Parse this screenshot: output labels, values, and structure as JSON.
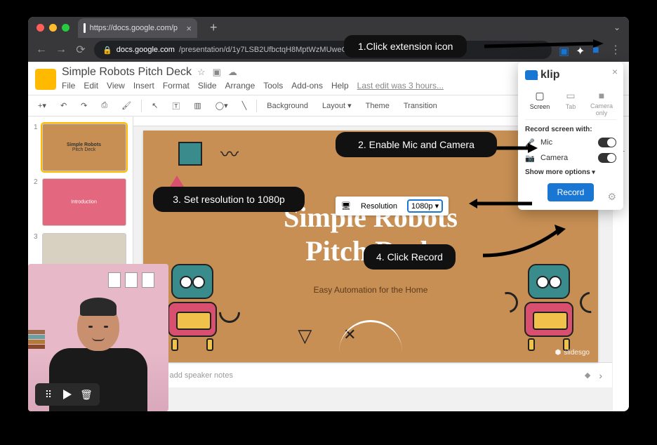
{
  "chrome": {
    "tab_title": "https://docs.google.com/p",
    "new_tab": "+",
    "back": "←",
    "forward": "→",
    "reload": "⟳",
    "url_host": "docs.google.com",
    "url_path": "/presentation/d/1y7LSB2UfbctqH8MptWzMUweCDC2g_xs",
    "menu": "⋮"
  },
  "app": {
    "title": "Simple Robots Pitch Deck",
    "star": "☆",
    "move": "▣",
    "cloud": "☁",
    "menus": [
      "File",
      "Edit",
      "View",
      "Insert",
      "Format",
      "Slide",
      "Arrange",
      "Tools",
      "Add-ons",
      "Help"
    ],
    "last_edit": "Last edit was 3 hours...",
    "slideshow_label": "Slide"
  },
  "toolbar": {
    "background": "Background",
    "layout": "Layout ▾",
    "theme": "Theme",
    "transition": "Transition"
  },
  "slides": {
    "s1": {
      "title": "Simple Robots",
      "sub": "Pitch Deck"
    },
    "s2": {
      "title": "Introduction"
    },
    "s3": {
      "title": ""
    }
  },
  "slide": {
    "title_l1": "Simple Robots",
    "title_l2": "Pitch Deck",
    "subtitle": "Easy Automation for the Home",
    "credit": "slidesgo"
  },
  "notes": {
    "placeholder": "k to add speaker notes"
  },
  "popup": {
    "brand": "klip",
    "mode_screen": "Screen",
    "mode_tab": "Tab",
    "mode_camera": "Camera only",
    "label": "Record screen with:",
    "mic": "Mic",
    "camera": "Camera",
    "more": "Show more options",
    "record": "Record"
  },
  "resolution": {
    "label": "Resolution",
    "value": "1080p",
    "caret": "▾"
  },
  "anno": {
    "a1": "1.Click extension icon",
    "a2": "2. Enable Mic and Camera",
    "a3": "3. Set resolution to 1080p",
    "a4": "4. Click Record"
  },
  "wc": {
    "drag": "⠿",
    "delete": "🗑"
  }
}
